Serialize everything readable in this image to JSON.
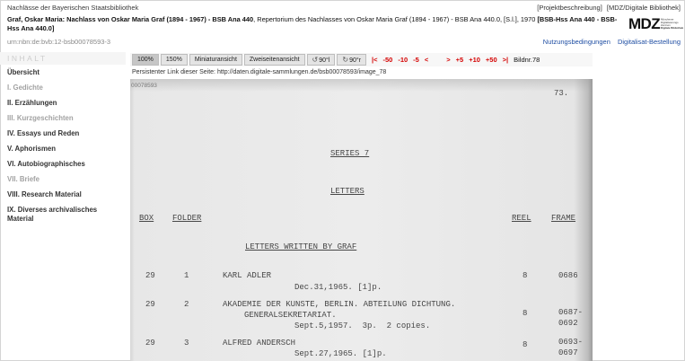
{
  "colors": {
    "link": "#1f4ea3",
    "nav": "#d40000",
    "toolbar_selected": "#c6c6c6"
  },
  "header": {
    "collection": "Nachlässe der Bayerischen Staatsbibliothek",
    "top_links": [
      "[Projektbeschreibung]",
      "[MDZ/Digitale Bibliothek]"
    ],
    "title": {
      "part1": "Graf, Oskar Maria: Nachlass von Oskar Maria Graf (1894 - 1967) - BSB Ana 440",
      "part2": ", Repertorium des Nachlasses von Oskar Maria Graf (1894 - 1967) - BSB Ana 440.0, [S.l.], 1970 ",
      "part3": "[BSB-Hss Ana 440 - BSB-Hss Ana 440.0]"
    },
    "urn": "urn:nbn:de:bvb:12-bsb00078593-3",
    "links": [
      "Nutzungsbedingungen",
      "Digitalisat-Bestellung"
    ]
  },
  "logo": {
    "mark": "MDZ",
    "lines": [
      "Münchener",
      "Digitalisierungs",
      "Zentrum",
      "Digitale Bibliothek"
    ]
  },
  "sidebar": {
    "heading": "INHALT",
    "items": [
      {
        "label": "Übersicht",
        "enabled": true
      },
      {
        "label": "I. Gedichte",
        "enabled": false
      },
      {
        "label": "II. Erzählungen",
        "enabled": true
      },
      {
        "label": "III. Kurzgeschichten",
        "enabled": false
      },
      {
        "label": "IV. Essays und Reden",
        "enabled": true
      },
      {
        "label": "V. Aphorismen",
        "enabled": true
      },
      {
        "label": "VI. Autobiographisches",
        "enabled": true
      },
      {
        "label": "VII. Briefe",
        "enabled": false
      },
      {
        "label": "VIII. Research Material",
        "enabled": true
      },
      {
        "label": "IX. Diverses archivalisches Material",
        "enabled": true
      }
    ]
  },
  "toolbar": {
    "zoom": [
      {
        "label": "100%",
        "selected": true
      },
      {
        "label": "150%",
        "selected": false
      }
    ],
    "views": [
      "Miniaturansicht",
      "Zweiseitenansicht"
    ],
    "rotate": [
      {
        "icon": "rotate-left-icon",
        "label": "90°l"
      },
      {
        "icon": "rotate-right-icon",
        "label": "90°r"
      }
    ],
    "nav_back": [
      "|<",
      "-50",
      "-10",
      "-5",
      "<"
    ],
    "nav_forward": [
      ">",
      "+5",
      "+10",
      "+50",
      ">|"
    ],
    "image_number": "Bildnr.78"
  },
  "permalink": {
    "label": "Persistenter Link dieser Seite:",
    "url": "http://daten.digitale-sammlungen.de/bsb00078593/image_78"
  },
  "scan": {
    "id": "00078593",
    "page_number": "73.",
    "series": "SERIES 7",
    "section": "LETTERS",
    "columns": [
      "BOX",
      "FOLDER",
      "REEL",
      "FRAME"
    ],
    "subsection": "LETTERS WRITTEN BY GRAF",
    "entries": [
      {
        "box": "29",
        "folder": "1",
        "name": [
          "KARL ADLER"
        ],
        "details": "Dec.31,1965. [1]p.",
        "reel": "8",
        "frame": [
          "0686"
        ]
      },
      {
        "box": "29",
        "folder": "2",
        "name": [
          "AKADEMIE DER KUNSTE, BERLIN. ABTEILUNG DICHTUNG.",
          "GENERALSEKRETARIAT."
        ],
        "details": "Sept.5,1957.  3p.  2 copies.",
        "reel": "8",
        "frame": [
          "0687-",
          "0692"
        ]
      },
      {
        "box": "29",
        "folder": "3",
        "name": [
          "ALFRED ANDERSCH"
        ],
        "details": "Sept.27,1965. [1]p.",
        "reel": "8",
        "frame": [
          "0693-",
          "0697"
        ]
      }
    ]
  }
}
